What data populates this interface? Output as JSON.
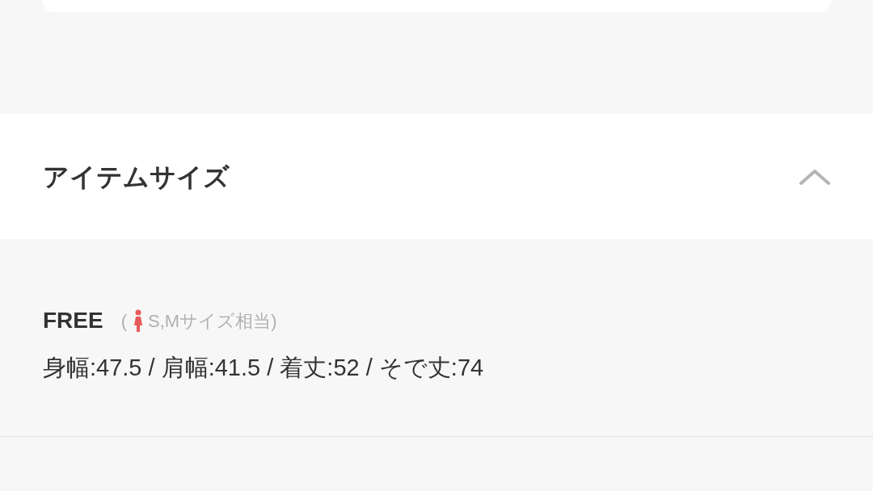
{
  "section": {
    "title": "アイテムサイズ",
    "expanded": true
  },
  "sizes": [
    {
      "name": "FREE",
      "note_open": "(",
      "note": "S,Mサイズ相当)",
      "measurements": "身幅:47.5 / 肩幅:41.5 / 着丈:52 / そで丈:74"
    }
  ]
}
